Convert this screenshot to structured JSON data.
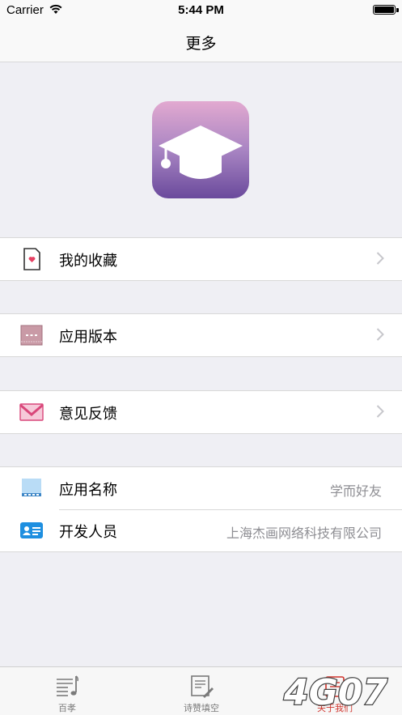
{
  "status_bar": {
    "carrier": "Carrier",
    "time": "5:44 PM",
    "battery_level": 1.0
  },
  "nav": {
    "title": "更多"
  },
  "logo": {
    "icon": "graduation-cap-icon",
    "gradient": [
      "#e2a9d0",
      "#6a4a9c"
    ]
  },
  "menu": [
    {
      "label": "我的收藏",
      "icon": "favorites-icon",
      "has_chevron": true
    },
    {
      "label": "应用版本",
      "icon": "version-icon",
      "has_chevron": true
    },
    {
      "label": "意见反馈",
      "icon": "mail-icon",
      "has_chevron": true
    }
  ],
  "info": {
    "app_name": {
      "label": "应用名称",
      "value": "学而好友",
      "icon": "app-name-icon"
    },
    "developer": {
      "label": "开发人员",
      "value": "上海杰画网络科技有限公司",
      "icon": "id-card-icon"
    }
  },
  "tabs": [
    {
      "label": "百孝",
      "icon": "music-list-icon",
      "active": false
    },
    {
      "label": "诗赞填空",
      "icon": "edit-doc-icon",
      "active": false
    },
    {
      "label": "关于我们",
      "icon": "about-icon",
      "active": true
    }
  ],
  "watermark": {
    "text": "4G07"
  },
  "colors": {
    "accent": "#d0342c",
    "background": "#efeff4",
    "secondary_text": "#8e8e93"
  }
}
